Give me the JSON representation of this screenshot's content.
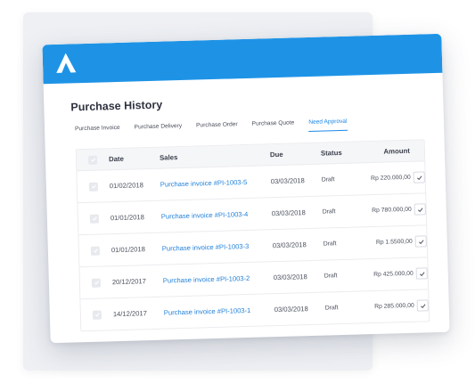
{
  "header": {
    "title": "Purchase History"
  },
  "tabs": [
    {
      "label": "Purchase Invoice",
      "active": false
    },
    {
      "label": "Purchase Delivery",
      "active": false
    },
    {
      "label": "Purchase Order",
      "active": false
    },
    {
      "label": "Purchase Quote",
      "active": false
    },
    {
      "label": "Need Approval",
      "active": true
    }
  ],
  "table": {
    "columns": [
      "Date",
      "Sales",
      "Due",
      "Status",
      "Amount"
    ],
    "rows": [
      {
        "date": "01/02/2018",
        "sales": "Purchase invoice #PI-1003-5",
        "due": "03/03/2018",
        "status": "Draft",
        "amount": "Rp 220.000,00"
      },
      {
        "date": "01/01/2018",
        "sales": "Purchase invoice #PI-1003-4",
        "due": "03/03/2018",
        "status": "Draft",
        "amount": "Rp 780.000,00"
      },
      {
        "date": "01/01/2018",
        "sales": "Purchase invoice #PI-1003-3",
        "due": "03/03/2018",
        "status": "Draft",
        "amount": "Rp 1.5500,00"
      },
      {
        "date": "20/12/2017",
        "sales": "Purchase invoice #PI-1003-2",
        "due": "03/03/2018",
        "status": "Draft",
        "amount": "Rp 425.000,00"
      },
      {
        "date": "14/12/2017",
        "sales": "Purchase invoice #PI-1003-1",
        "due": "03/03/2018",
        "status": "Draft",
        "amount": "Rp 285.000,00"
      }
    ]
  },
  "colors": {
    "accent": "#1e93e6",
    "link": "#1f7fd8"
  },
  "icons": {
    "logo": "a-logo-icon",
    "check": "check-icon"
  }
}
